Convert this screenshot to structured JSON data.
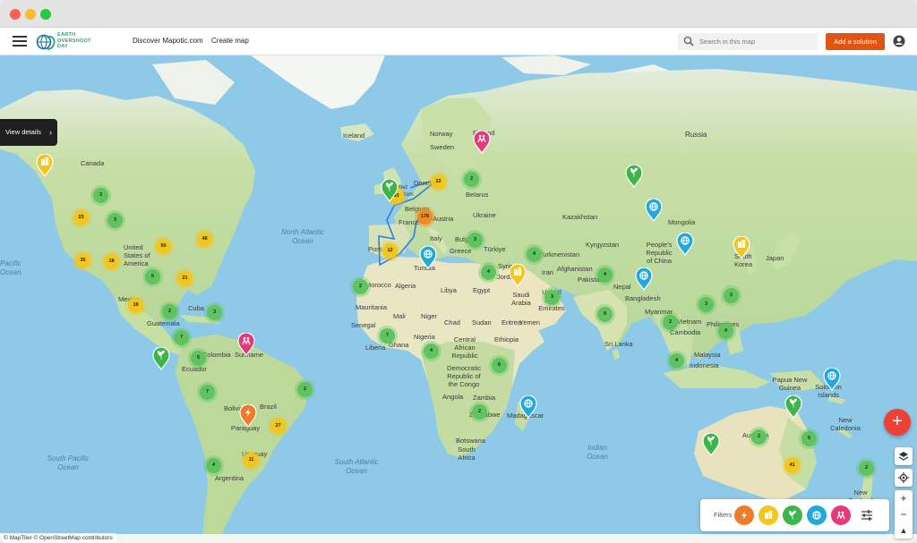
{
  "header": {
    "logo_text": [
      "EARTH",
      "OVERSHOOT",
      "DAY"
    ],
    "nav": [
      "Discover Mapotic.com",
      "Create map"
    ],
    "search_placeholder": "Search in this map",
    "add_button": "Add a solution"
  },
  "panel": {
    "view_details": "View details"
  },
  "filters": {
    "label": "Filters",
    "chips": [
      {
        "icon": "energy-icon",
        "color": "#f07a2a"
      },
      {
        "icon": "buildings-icon",
        "color": "#f2c61e"
      },
      {
        "icon": "plant-icon",
        "color": "#3cb54a"
      },
      {
        "icon": "globe-icon",
        "color": "#21a8dd"
      },
      {
        "icon": "people-icon",
        "color": "#e4397a"
      }
    ]
  },
  "attribution": "© MapTiler © OpenStreetMap contributors",
  "oceans": [
    "North Atlantic Ocean",
    "South Atlantic Ocean",
    "Indian Ocean",
    "South Pacific Ocean",
    "Pacific Ocean"
  ],
  "places": [
    "Russia",
    "Canada",
    "United States of America",
    "Mexico",
    "Cuba",
    "Guatemala",
    "Colombia",
    "Ecuador",
    "Suriname",
    "Brazil",
    "Bolivia",
    "Paraguay",
    "Uruguay",
    "Argentina",
    "Iceland",
    "Norway",
    "Sweden",
    "Finland",
    "Denmark",
    "United Kingdom",
    "Belgium",
    "France",
    "Austria",
    "Italy",
    "Portugal",
    "Belarus",
    "Ukraine",
    "Bulgaria",
    "Greece",
    "Türkiye",
    "Syria",
    "Jordan",
    "Tunisia",
    "Morocco",
    "Algeria",
    "Libya",
    "Egypt",
    "Mauritania",
    "Mali",
    "Niger",
    "Chad",
    "Sudan",
    "Eritrea",
    "Ethiopia",
    "Senegal",
    "Liberia",
    "Ghana",
    "Nigeria",
    "Central African Republic",
    "Democratic Republic of the Congo",
    "Angola",
    "Zambia",
    "Zimbabwe",
    "Botswana",
    "South Africa",
    "Madagascar",
    "Saudi Arabia",
    "Yemen",
    "United Arab Emirates",
    "Iran",
    "Turkmenistan",
    "Afghanistan",
    "Pakistan",
    "Kazakhstan",
    "Kyrgyzstan",
    "Mongolia",
    "People's Republic of China",
    "Nepal",
    "Bangladesh",
    "Myanmar",
    "Sri Lanka",
    "Vietnam",
    "Cambodia",
    "Philippines",
    "Malaysia",
    "Indonesia",
    "South Korea",
    "Japan",
    "Papua New Guinea",
    "Solomon Islands",
    "Australia",
    "New Caledonia",
    "New Zealand"
  ],
  "clusters": [
    {
      "c": "g",
      "n": "2"
    },
    {
      "c": "g",
      "n": "3"
    },
    {
      "c": "y",
      "n": "23"
    },
    {
      "c": "g",
      "n": "3"
    },
    {
      "c": "y",
      "n": "50"
    },
    {
      "c": "y",
      "n": "48"
    },
    {
      "c": "y",
      "n": "35"
    },
    {
      "c": "y",
      "n": "18"
    },
    {
      "c": "g",
      "n": "6"
    },
    {
      "c": "y",
      "n": "21"
    },
    {
      "c": "y",
      "n": "19"
    },
    {
      "c": "g",
      "n": "2"
    },
    {
      "c": "g",
      "n": "3"
    },
    {
      "c": "g",
      "n": "7"
    },
    {
      "c": "g",
      "n": "5"
    },
    {
      "c": "g",
      "n": "7"
    },
    {
      "c": "g",
      "n": "2"
    },
    {
      "c": "y",
      "n": "27"
    },
    {
      "c": "y",
      "n": "11"
    },
    {
      "c": "g",
      "n": "4"
    },
    {
      "c": "y",
      "n": "93"
    },
    {
      "c": "y",
      "n": "22"
    },
    {
      "c": "o",
      "n": "176"
    },
    {
      "c": "y",
      "n": "12"
    },
    {
      "c": "g",
      "n": "2"
    },
    {
      "c": "g",
      "n": "3"
    },
    {
      "c": "g",
      "n": "4"
    },
    {
      "c": "g",
      "n": "4"
    },
    {
      "c": "g",
      "n": "2"
    },
    {
      "c": "g",
      "n": "7"
    },
    {
      "c": "g",
      "n": "4"
    },
    {
      "c": "g",
      "n": "6"
    },
    {
      "c": "g",
      "n": "2"
    },
    {
      "c": "g",
      "n": "3"
    },
    {
      "c": "g",
      "n": "4"
    },
    {
      "c": "g",
      "n": "9"
    },
    {
      "c": "g",
      "n": "2"
    },
    {
      "c": "g",
      "n": "4"
    },
    {
      "c": "g",
      "n": "3"
    },
    {
      "c": "g",
      "n": "2"
    },
    {
      "c": "g",
      "n": "4"
    },
    {
      "c": "g",
      "n": "2"
    },
    {
      "c": "g",
      "n": "5"
    },
    {
      "c": "y",
      "n": "41"
    },
    {
      "c": "g",
      "n": "2"
    }
  ],
  "pins": [
    {
      "icon": "buildings-icon",
      "color": "#f2c61e"
    },
    {
      "icon": "plant-icon",
      "color": "#3cb54a"
    },
    {
      "icon": "energy-icon",
      "color": "#f07a2a"
    },
    {
      "icon": "people-icon",
      "color": "#e4397a"
    },
    {
      "icon": "plant-icon",
      "color": "#3cb54a"
    },
    {
      "icon": "people-icon",
      "color": "#e4397a"
    },
    {
      "icon": "globe-icon",
      "color": "#21a8dd"
    },
    {
      "icon": "buildings-icon",
      "color": "#f2c61e"
    },
    {
      "icon": "plant-icon",
      "color": "#3cb54a"
    },
    {
      "icon": "globe-icon",
      "color": "#21a8dd"
    },
    {
      "icon": "globe-icon",
      "color": "#21a8dd"
    },
    {
      "icon": "globe-icon",
      "color": "#21a8dd"
    },
    {
      "icon": "buildings-icon",
      "color": "#f2c61e"
    },
    {
      "icon": "globe-icon",
      "color": "#21a8dd"
    },
    {
      "icon": "plant-icon",
      "color": "#3cb54a"
    },
    {
      "icon": "plant-icon",
      "color": "#3cb54a"
    },
    {
      "icon": "globe-icon",
      "color": "#21a8dd"
    }
  ]
}
